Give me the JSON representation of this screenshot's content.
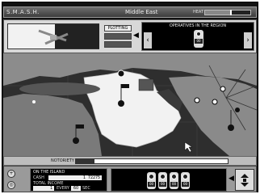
{
  "titlebar": {
    "app_title": "S.M.A.S.H.",
    "region": "Middle East",
    "heat_label": "HEAT",
    "heat_level": 0.55
  },
  "toppanel": {
    "plotting_buttons": [
      "PLOTTING",
      "",
      ""
    ],
    "operatives_title": "OPERATIVES IN THE REGION",
    "operative_counts": [
      "00"
    ]
  },
  "notoriety": {
    "label": "NOTORIETY",
    "fill": 0.12,
    "status_text": "",
    "right_text": ""
  },
  "island": {
    "title": "ON THE ISLAND",
    "cash_label": "CASH",
    "cash_value": "1 72275",
    "income_label": "TOTAL INCOME",
    "income_value": "1",
    "every_label": "EVERY",
    "every_value": "60",
    "sec_label": "SEC"
  },
  "agents": {
    "counts": [
      "00",
      "00",
      "00",
      "00"
    ]
  },
  "icons": [
    "radar-icon",
    "arrow-left-icon",
    "arrow-right-icon",
    "agent-icon",
    "map-pin-icon",
    "zoom-icon",
    "settings-icon"
  ]
}
